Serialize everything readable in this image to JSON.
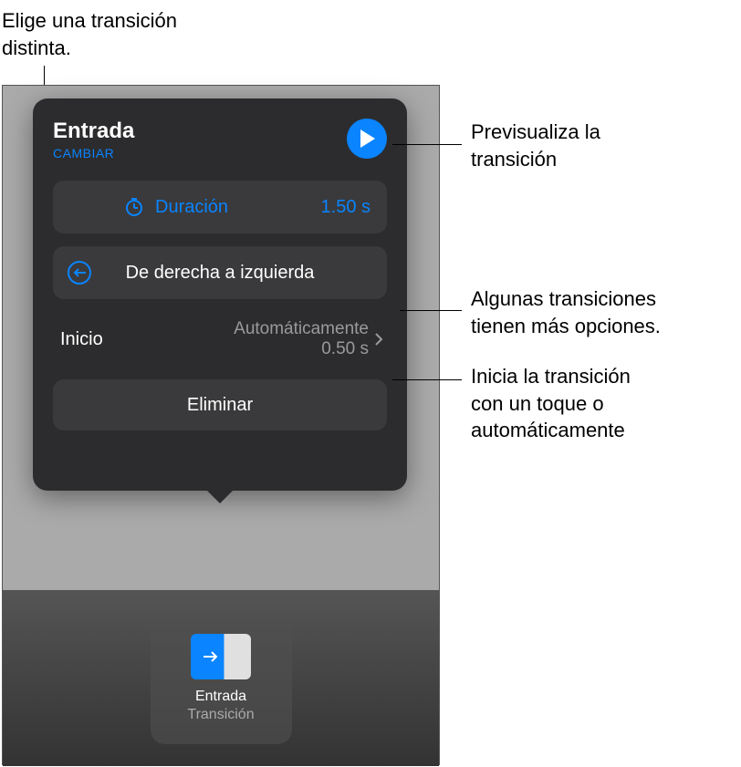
{
  "annotations": {
    "top_left": "Elige una transición\ndistinta.",
    "preview": "Previsualiza la\ntransición",
    "options": "Algunas transiciones\ntienen más opciones.",
    "start": "Inicia la transición\ncon un toque o\nautomáticamente"
  },
  "popover": {
    "title": "Entrada",
    "change_label": "CAMBIAR",
    "duration": {
      "label": "Duración",
      "value": "1.50 s"
    },
    "direction": {
      "label": "De derecha a izquierda"
    },
    "start": {
      "label": "Inicio",
      "mode": "Automáticamente",
      "delay": "0.50 s"
    },
    "delete_label": "Eliminar"
  },
  "thumbnail": {
    "title": "Entrada",
    "subtitle": "Transición"
  }
}
